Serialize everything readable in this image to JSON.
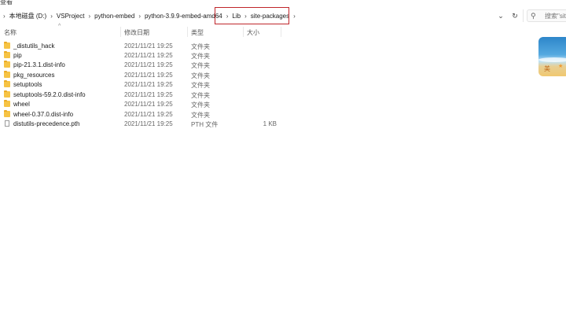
{
  "menu": {
    "view_label": "查看"
  },
  "breadcrumb": {
    "items": [
      "本地磁盘 (D:)",
      "VSProject",
      "python-embed",
      "python-3.9.9-embed-amd64",
      "Lib",
      "site-packages"
    ]
  },
  "search": {
    "placeholder": "搜索\"site"
  },
  "columns": {
    "name": "名称",
    "date": "修改日期",
    "type": "类型",
    "size": "大小"
  },
  "files": [
    {
      "name": "_distutils_hack",
      "date": "2021/11/21 19:25",
      "type": "文件夹",
      "size": "",
      "icon": "folder-icon"
    },
    {
      "name": "pip",
      "date": "2021/11/21 19:25",
      "type": "文件夹",
      "size": "",
      "icon": "folder-icon"
    },
    {
      "name": "pip-21.3.1.dist-info",
      "date": "2021/11/21 19:25",
      "type": "文件夹",
      "size": "",
      "icon": "folder-icon"
    },
    {
      "name": "pkg_resources",
      "date": "2021/11/21 19:25",
      "type": "文件夹",
      "size": "",
      "icon": "folder-icon"
    },
    {
      "name": "setuptools",
      "date": "2021/11/21 19:25",
      "type": "文件夹",
      "size": "",
      "icon": "folder-icon"
    },
    {
      "name": "setuptools-59.2.0.dist-info",
      "date": "2021/11/21 19:25",
      "type": "文件夹",
      "size": "",
      "icon": "folder-icon"
    },
    {
      "name": "wheel",
      "date": "2021/11/21 19:25",
      "type": "文件夹",
      "size": "",
      "icon": "folder-icon"
    },
    {
      "name": "wheel-0.37.0.dist-info",
      "date": "2021/11/21 19:25",
      "type": "文件夹",
      "size": "",
      "icon": "folder-icon"
    },
    {
      "name": "distutils-precedence.pth",
      "date": "2021/11/21 19:25",
      "type": "PTH 文件",
      "size": "1 KB",
      "icon": "file-icon"
    }
  ],
  "thumbnail": {
    "text": "美"
  },
  "colors": {
    "highlight_border": "#c0262b",
    "folder": "#f6c344"
  }
}
